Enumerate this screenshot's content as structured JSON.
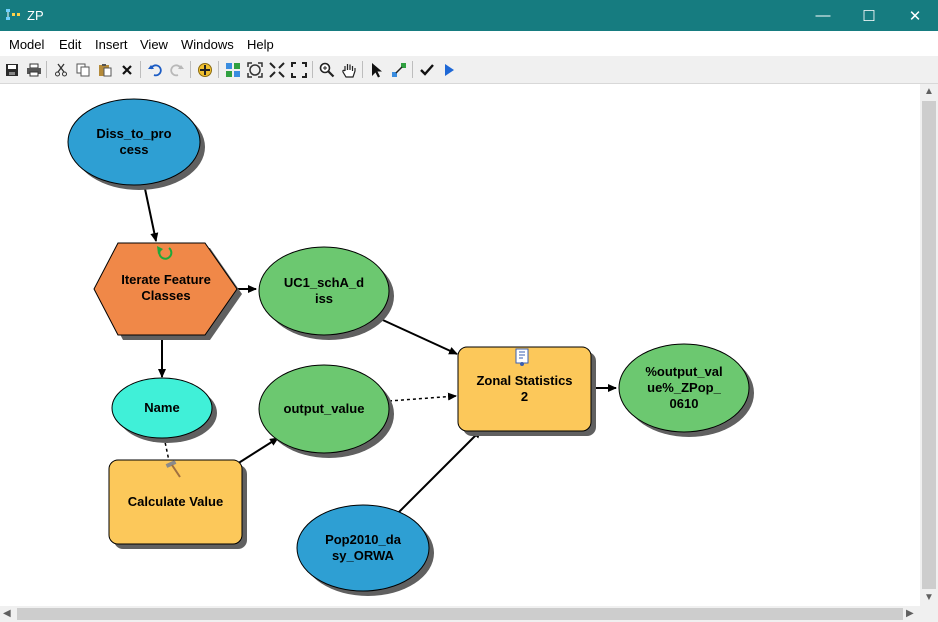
{
  "window": {
    "title": "ZP",
    "controls": {
      "minimize": "—",
      "maximize": "☐",
      "close": "✕"
    }
  },
  "menu": [
    "Model",
    "Edit",
    "Insert",
    "View",
    "Windows",
    "Help"
  ],
  "toolbar_icons": [
    "save-icon",
    "print-icon",
    "cut-icon",
    "copy-icon",
    "paste-icon",
    "delete-icon",
    "undo-icon",
    "redo-icon",
    "add-data-icon",
    "auto-layout-icon",
    "full-extent-icon",
    "zoom-in-fixed-icon",
    "zoom-out-fixed-icon",
    "zoom-icon",
    "pan-icon",
    "select-icon",
    "connect-icon",
    "validate-icon",
    "run-icon"
  ],
  "colors": {
    "titlebar": "#167c80",
    "input_data": "#2e9fd3",
    "derived_data": "#6cc870",
    "variable": "#40f0d8",
    "tool": "#fcc85a",
    "iterator": "#f08848"
  },
  "nodes": {
    "diss": {
      "label": "Diss_to_pro cess",
      "lines": [
        "Diss_to_pro",
        "cess"
      ]
    },
    "iterate": {
      "label": "Iterate Feature Classes",
      "lines": [
        "Iterate Feature",
        "Classes"
      ]
    },
    "uc1": {
      "label": "UC1_schA_d iss",
      "lines": [
        "UC1_schA_d",
        "iss"
      ]
    },
    "name": {
      "label": "Name"
    },
    "output_value": {
      "label": "output_value"
    },
    "calc": {
      "label": "Calculate Value"
    },
    "zonal": {
      "label": "Zonal Statistics 2",
      "lines": [
        "Zonal Statistics",
        "2"
      ]
    },
    "pop": {
      "label": "Pop2010_da sy_ORWA",
      "lines": [
        "Pop2010_da",
        "sy_ORWA"
      ]
    },
    "output": {
      "label": "%output_val ue%_ZPop_ 0610",
      "lines": [
        "%output_val",
        "ue%_ZPop_",
        "0610"
      ]
    }
  }
}
